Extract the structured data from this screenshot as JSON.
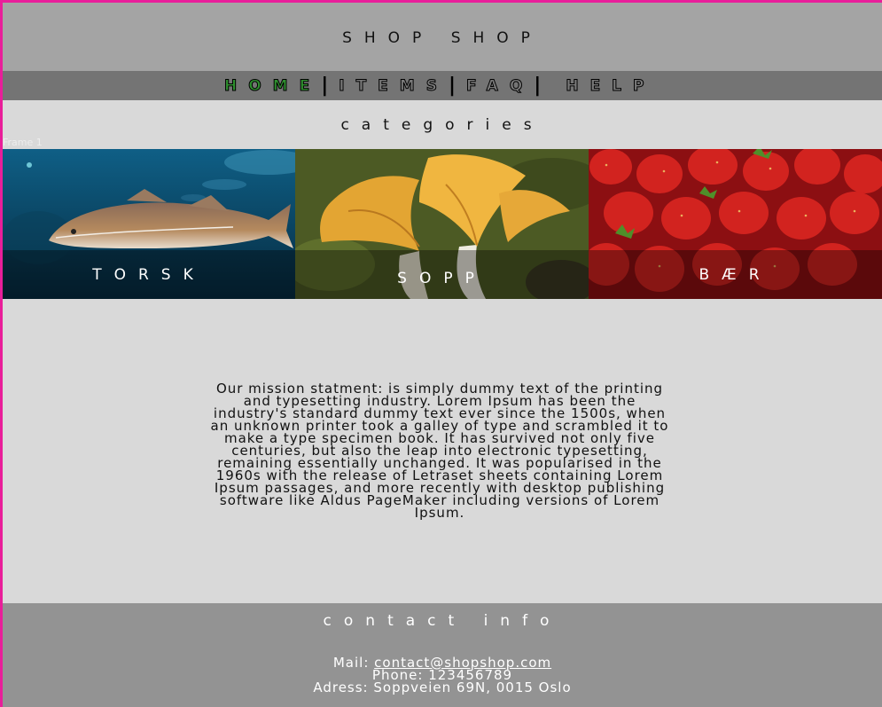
{
  "header": {
    "title": "SHOP SHOP"
  },
  "nav": {
    "items": [
      {
        "label": "HOME"
      },
      {
        "label": "ITEMS"
      },
      {
        "label": "FAQ"
      },
      {
        "label": "HELP"
      }
    ],
    "separator": "|"
  },
  "categories": {
    "title": "categories",
    "frame_label": "Frame 1",
    "items": [
      {
        "label": "TORSK"
      },
      {
        "label": "SOPP"
      },
      {
        "label": "BÆR"
      }
    ]
  },
  "mission": {
    "text": "Our mission statment: is simply dummy text of the printing and typesetting industry. Lorem Ipsum has been the industry's standard dummy text ever since the 1500s, when an unknown printer took a galley of type and scrambled it to make a type specimen book. It has survived not only five centuries, but also the leap into electronic typesetting, remaining essentially unchanged. It was popularised in the 1960s with the release of Letraset sheets containing Lorem Ipsum passages, and more recently with desktop publishing software like Aldus PageMaker including versions of Lorem Ipsum."
  },
  "footer": {
    "title": "contact info",
    "mail_label": "Mail: ",
    "mail_value": "contact@shopshop.com",
    "phone": "Phone: 123456789",
    "address": "Adress: Soppveien 69N, 0015 Oslo"
  },
  "colors": {
    "page_border": "#e91e9a",
    "header_bg": "#a4a4a4",
    "nav_bg": "#747474",
    "active_nav": "#2f8f2f",
    "body_bg": "#d9d9d9",
    "footer_bg": "#939393"
  }
}
